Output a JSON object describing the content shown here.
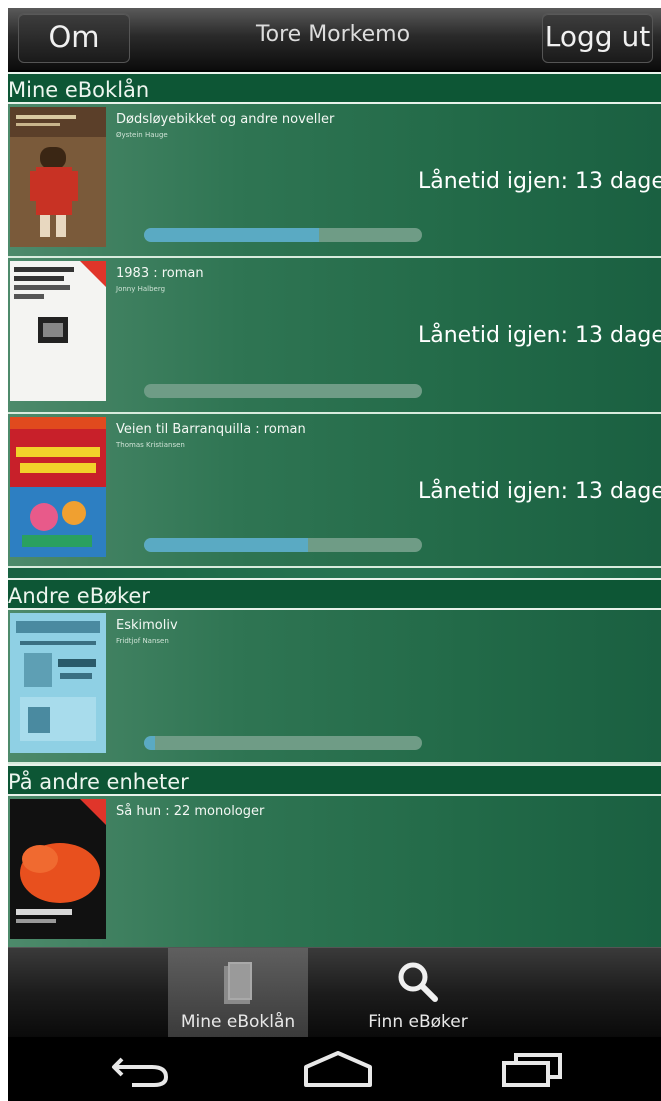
{
  "topbar": {
    "about_label": "Om",
    "user_name": "Tore Morkemo",
    "logout_label": "Logg ut"
  },
  "sections": {
    "my_loans": "Mine eBoklån",
    "other_books": "Andre eBøker",
    "other_devices": "På andre enheter"
  },
  "loans": [
    {
      "title": "Dødsløyebikket og andre noveller",
      "author": "Øystein Hauge",
      "loan_text": "Lånetid igjen: 13 dage",
      "progress": 0.63
    },
    {
      "title": "1983 : roman",
      "author": "Jonny Halberg",
      "loan_text": "Lånetid igjen: 13 dage",
      "progress": 0.0
    },
    {
      "title": "Veien til Barranquilla : roman",
      "author": "Thomas Kristiansen",
      "loan_text": "Lånetid igjen: 13 dage",
      "progress": 0.59
    }
  ],
  "other": [
    {
      "title": "Eskimoliv",
      "author": "Fridtjof Nansen",
      "progress": 0.04
    }
  ],
  "devices": [
    {
      "title": "Så hun : 22 monologer"
    }
  ],
  "tabs": {
    "my_loans": "Mine eBoklån",
    "find_books": "Finn eBøker"
  },
  "colors": {
    "accent": "#5aaac3",
    "list_green": "#1d6a48",
    "header_green": "#0d5635"
  }
}
